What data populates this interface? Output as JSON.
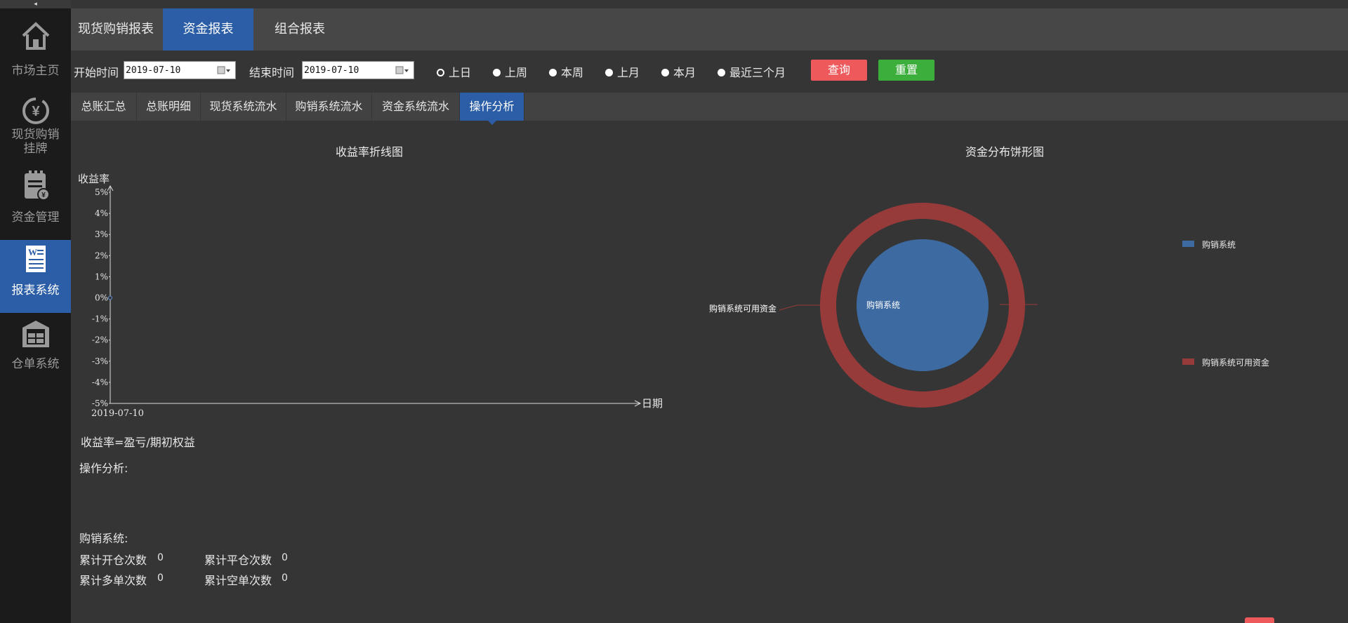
{
  "sidebar": {
    "collapse_glyph": "◂",
    "items": [
      {
        "label": "市场主页",
        "icon": "home-icon"
      },
      {
        "label": "现货购销\n挂牌",
        "icon": "yen-cycle-icon"
      },
      {
        "label": "资金管理",
        "icon": "fund-clipboard-icon"
      },
      {
        "label": "报表系统",
        "icon": "report-document-icon",
        "active": true
      },
      {
        "label": "仓单系统",
        "icon": "warehouse-icon"
      }
    ]
  },
  "top_tabs": [
    "现货购销报表",
    "资金报表",
    "组合报表"
  ],
  "top_tab_active": "资金报表",
  "filters": {
    "start_label": "开始时间",
    "start_value": "2019-07-10",
    "end_label": "结束时间",
    "end_value": "2019-07-10",
    "ranges": [
      "上日",
      "上周",
      "本周",
      "上月",
      "本月",
      "最近三个月"
    ],
    "selected_range": "上日",
    "query_label": "查询",
    "reset_label": "重置"
  },
  "sub_tabs": [
    "总账汇总",
    "总账明细",
    "现货系统流水",
    "购销系统流水",
    "资金系统流水",
    "操作分析"
  ],
  "sub_tab_active": "操作分析",
  "line_chart_title": "收益率折线图",
  "pie_chart_title": "资金分布饼形图",
  "chart_data": [
    {
      "type": "line",
      "title": "收益率折线图",
      "ylabel": "收益率",
      "xlabel": "日期",
      "y_ticks": [
        "5%",
        "4%",
        "3%",
        "2%",
        "1%",
        "0%",
        "-1%",
        "-2%",
        "-3%",
        "-4%",
        "-5%"
      ],
      "ylim": [
        -5,
        5
      ],
      "x": [
        "2019-07-10"
      ],
      "series": [
        {
          "values": [
            0
          ]
        }
      ]
    },
    {
      "type": "pie",
      "title": "资金分布饼形图",
      "rings": [
        {
          "label": "购销系统",
          "value": 1,
          "color": "#3d6aa1"
        },
        {
          "label": "购销系统可用资金",
          "value": 1,
          "color": "#973b3a"
        }
      ],
      "legend": [
        "购销系统",
        "购销系统可用资金"
      ],
      "legend_placement": "right"
    }
  ],
  "formula": "收益率=盈亏/期初权益",
  "analysis_label": "操作分析:",
  "section_label": "购销系统:",
  "stats": [
    {
      "label": "累计开仓次数",
      "value": "0"
    },
    {
      "label": "累计平仓次数",
      "value": "0"
    },
    {
      "label": "累计多单次数",
      "value": "0"
    },
    {
      "label": "累计空单次数",
      "value": "0"
    }
  ],
  "colors": {
    "accent": "#2b5ea6",
    "query": "#ee5a5c",
    "reset": "#3bae3c",
    "ring": "#973b3a",
    "core": "#3d6aa1"
  }
}
